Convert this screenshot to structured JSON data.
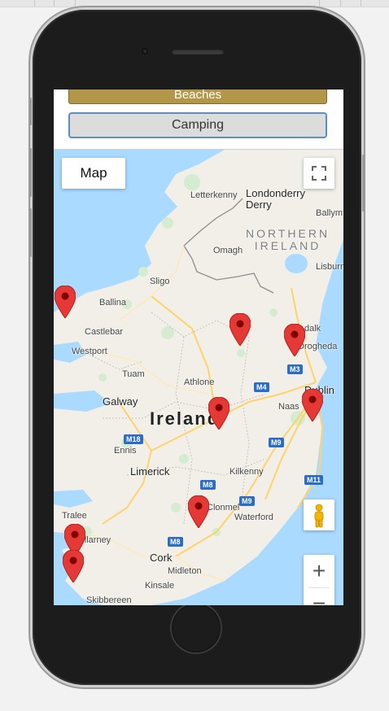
{
  "buttons": {
    "beaches_label": "Beaches",
    "camping_label": "Camping"
  },
  "map": {
    "type_control_label": "Map",
    "zoom_in_label": "+",
    "zoom_out_label": "−",
    "country_label": "Ireland",
    "region_label_1": "NORTHERN",
    "region_label_2": "IRELAND",
    "places": {
      "letterkenny": "Letterkenny",
      "londonderry": "Londonderry",
      "derry": "Derry",
      "ballym": "Ballym",
      "omagh": "Omagh",
      "lisburn": "Lisburn",
      "sligo": "Sligo",
      "ballina": "Ballina",
      "castlebar": "Castlebar",
      "westport": "Westport",
      "dundalk": "dalk",
      "drogheda": "Drogheda",
      "tuam": "Tuam",
      "athlone": "Athlone",
      "galway": "Galway",
      "dublin": "Dublin",
      "naas": "Naas",
      "ennis": "Ennis",
      "limerick": "Limerick",
      "kilkenny": "Kilkenny",
      "tralee": "Tralee",
      "killarney": "Killarney",
      "clonmel": "Clonmel",
      "waterford": "Waterford",
      "cork": "Cork",
      "midleton": "Midleton",
      "kinsale": "Kinsale",
      "skibbereen": "Skibbereen"
    },
    "roads": [
      "M3",
      "M4",
      "M18",
      "M9",
      "M8",
      "M9",
      "M11",
      "M8"
    ],
    "marker_color": "#e53935",
    "land_color": "#f1efe8",
    "water_color": "#aadaff"
  }
}
